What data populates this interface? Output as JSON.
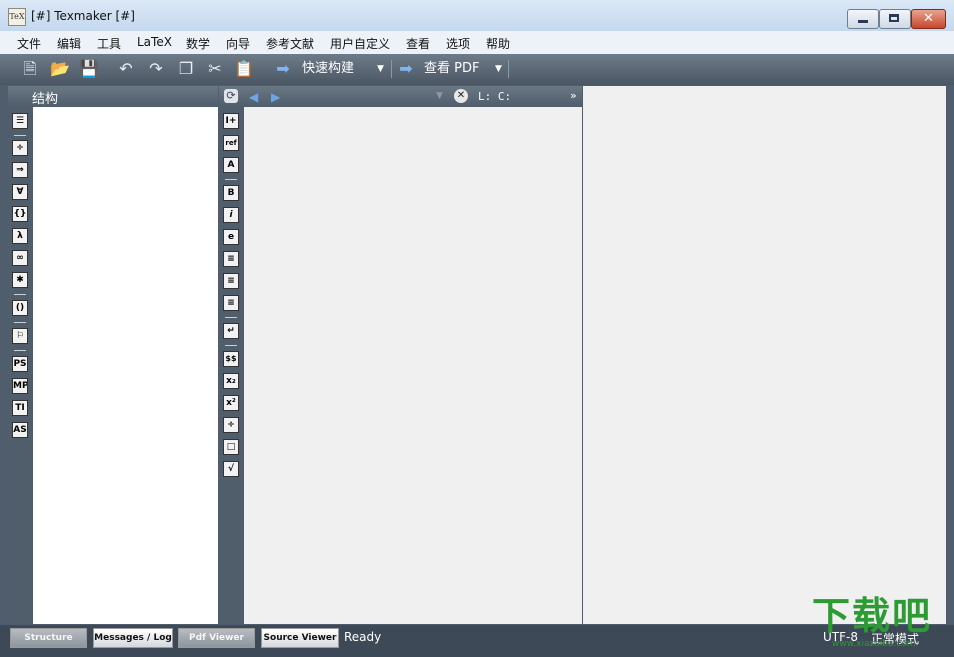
{
  "window": {
    "title": "[#] Texmaker [#]",
    "app_icon_text": "TeX"
  },
  "menubar": {
    "items": [
      "文件",
      "编辑",
      "工具",
      "LaTeX",
      "数学",
      "向导",
      "参考文献",
      "用户自定义",
      "查看",
      "选项",
      "帮助"
    ]
  },
  "toolbar": {
    "quick_build": "快速构建",
    "view_pdf": "查看 PDF"
  },
  "structure_panel": {
    "title": "结构",
    "icons": [
      "☰",
      "÷",
      "⇒",
      "∀",
      "{}",
      "λ",
      "∞",
      "✱",
      "()",
      "⚐",
      "PS",
      "MP",
      "TI",
      "AS"
    ]
  },
  "editor_panel": {
    "position_label": "L: C:",
    "icons": [
      "I+",
      "ref",
      "A",
      "B",
      "i",
      "e",
      "≡",
      "≡",
      "≡",
      "↵",
      "$$",
      "x₂",
      "x²",
      "÷",
      "□",
      "√"
    ]
  },
  "statusbar": {
    "buttons": [
      "Structure",
      "Messages / Log",
      "Pdf Viewer",
      "Source Viewer"
    ],
    "status": "Ready",
    "encoding": "UTF-8",
    "mode": "正常模式"
  },
  "watermark": {
    "main": "下载吧",
    "sub": "www.xiazaiba.com"
  }
}
